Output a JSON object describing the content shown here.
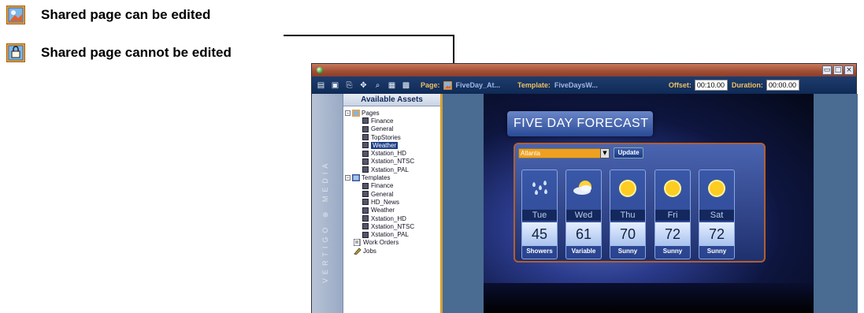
{
  "legend": [
    {
      "label": "Shared page can be edited",
      "icon": "shared-editable-page-icon"
    },
    {
      "label": "Shared page cannot be edited",
      "icon": "shared-locked-page-icon"
    }
  ],
  "window": {
    "toolbar": {
      "page_label": "Page:",
      "page_value": "FiveDay_At...",
      "template_label": "Template:",
      "template_value": "FiveDaysW...",
      "offset_label": "Offset:",
      "offset_value": "00:10.00",
      "duration_label": "Duration:",
      "duration_value": "00:00.00"
    },
    "brand_vertical": "VERTIGO ⊗ MEDIA",
    "assets": {
      "header": "Available Assets",
      "tree": [
        {
          "label": "Pages",
          "type": "folder",
          "expanded": true,
          "children": [
            "Finance",
            "General",
            "TopStories",
            "Weather",
            "Xstation_HD",
            "Xstation_NTSC",
            "Xstation_PAL"
          ],
          "selected_child": "Weather"
        },
        {
          "label": "Templates",
          "type": "folder",
          "expanded": true,
          "children": [
            "Finance",
            "General",
            "HD_News",
            "Weather",
            "Xstation_HD",
            "Xstation_NTSC",
            "Xstation_PAL"
          ]
        },
        {
          "label": "Work Orders",
          "type": "item"
        },
        {
          "label": "Jobs",
          "type": "item"
        }
      ]
    },
    "preview": {
      "title": "FIVE DAY FORECAST",
      "city": "Atlanta",
      "update_button": "Update",
      "days": [
        {
          "day": "Tue",
          "temp": "45",
          "cond": "Showers",
          "icon": "rain-icon"
        },
        {
          "day": "Wed",
          "temp": "61",
          "cond": "Variable",
          "icon": "partly-cloudy-icon"
        },
        {
          "day": "Thu",
          "temp": "70",
          "cond": "Sunny",
          "icon": "sun-icon"
        },
        {
          "day": "Fri",
          "temp": "72",
          "cond": "Sunny",
          "icon": "sun-icon"
        },
        {
          "day": "Sat",
          "temp": "72",
          "cond": "Sunny",
          "icon": "sun-icon"
        }
      ]
    }
  },
  "colors": {
    "titlebar": "#a04e36",
    "toolbar": "#0f2a55",
    "selection": "#1c3f86",
    "toolbar_label": "#f0c060"
  }
}
